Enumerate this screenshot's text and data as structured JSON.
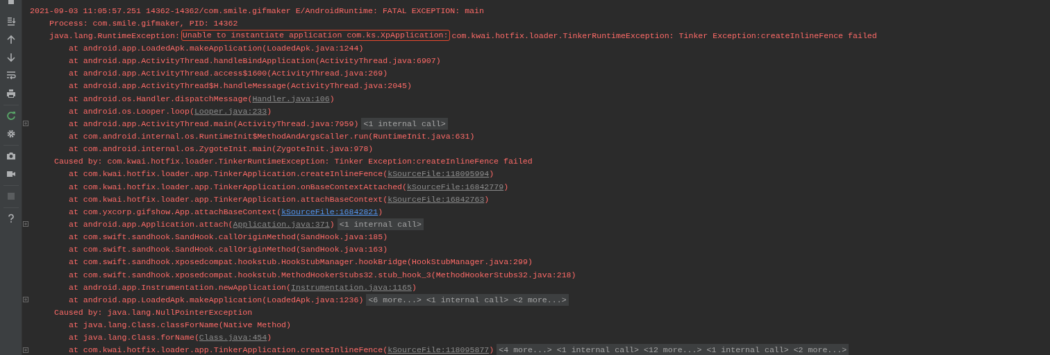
{
  "log": {
    "lines": [
      {
        "kind": "header",
        "foldable": false,
        "segments": [
          {
            "kind": "plain",
            "text": "2021-09-03 11:05:57.251 14362-14362/com.smile.gifmaker E/AndroidRuntime: FATAL EXCEPTION: main"
          }
        ]
      },
      {
        "kind": "detail",
        "foldable": false,
        "segments": [
          {
            "kind": "plain",
            "text": "Process: com.smile.gifmaker, PID: 14362"
          }
        ]
      },
      {
        "kind": "detail",
        "foldable": false,
        "segments": [
          {
            "kind": "plain",
            "text": "java.lang.RuntimeException:"
          },
          {
            "kind": "boxed",
            "text": "Unable to instantiate application com.ks.XpApplication:"
          },
          {
            "kind": "plain",
            "text": "com.kwai.hotfix.loader.TinkerRuntimeException: Tinker Exception:createInlineFence failed"
          }
        ]
      },
      {
        "kind": "frame",
        "foldable": false,
        "segments": [
          {
            "kind": "plain",
            "text": "at android.app.LoadedApk.makeApplication(LoadedApk.java:1244)"
          }
        ]
      },
      {
        "kind": "frame",
        "foldable": false,
        "segments": [
          {
            "kind": "plain",
            "text": "at android.app.ActivityThread.handleBindApplication(ActivityThread.java:6907)"
          }
        ]
      },
      {
        "kind": "frame",
        "foldable": false,
        "segments": [
          {
            "kind": "plain",
            "text": "at android.app.ActivityThread.access$1600(ActivityThread.java:269)"
          }
        ]
      },
      {
        "kind": "frame",
        "foldable": false,
        "segments": [
          {
            "kind": "plain",
            "text": "at android.app.ActivityThread$H.handleMessage(ActivityThread.java:2045)"
          }
        ]
      },
      {
        "kind": "frame",
        "foldable": false,
        "segments": [
          {
            "kind": "plain",
            "text": "at android.os.Handler.dispatchMessage("
          },
          {
            "kind": "link",
            "focused": false,
            "text": "Handler.java:106"
          },
          {
            "kind": "plain",
            "text": ")"
          }
        ]
      },
      {
        "kind": "frame",
        "foldable": false,
        "segments": [
          {
            "kind": "plain",
            "text": "at android.os.Looper.loop("
          },
          {
            "kind": "link",
            "focused": false,
            "text": "Looper.java:233"
          },
          {
            "kind": "plain",
            "text": ")"
          }
        ]
      },
      {
        "kind": "frame",
        "foldable": true,
        "segments": [
          {
            "kind": "plain",
            "text": "at android.app.ActivityThread.main(ActivityThread.java:7959)"
          },
          {
            "kind": "fold",
            "text": "<1 internal call>"
          }
        ]
      },
      {
        "kind": "frame",
        "foldable": false,
        "segments": [
          {
            "kind": "plain",
            "text": "at com.android.internal.os.RuntimeInit$MethodAndArgsCaller.run(RuntimeInit.java:631)"
          }
        ]
      },
      {
        "kind": "frame",
        "foldable": false,
        "segments": [
          {
            "kind": "plain",
            "text": "at com.android.internal.os.ZygoteInit.main(ZygoteInit.java:978)"
          }
        ]
      },
      {
        "kind": "cause",
        "foldable": false,
        "segments": [
          {
            "kind": "plain",
            "text": "Caused by: com.kwai.hotfix.loader.TinkerRuntimeException: Tinker Exception:createInlineFence failed"
          }
        ]
      },
      {
        "kind": "frame",
        "foldable": false,
        "segments": [
          {
            "kind": "plain",
            "text": "at com.kwai.hotfix.loader.app.TinkerApplication.createInlineFence("
          },
          {
            "kind": "link",
            "focused": false,
            "text": "kSourceFile:118095994"
          },
          {
            "kind": "plain",
            "text": ")"
          }
        ]
      },
      {
        "kind": "frame",
        "foldable": false,
        "segments": [
          {
            "kind": "plain",
            "text": "at com.kwai.hotfix.loader.app.TinkerApplication.onBaseContextAttached("
          },
          {
            "kind": "link",
            "focused": false,
            "text": "kSourceFile:16842779"
          },
          {
            "kind": "plain",
            "text": ")"
          }
        ]
      },
      {
        "kind": "frame",
        "foldable": false,
        "segments": [
          {
            "kind": "plain",
            "text": "at com.kwai.hotfix.loader.app.TinkerApplication.attachBaseContext("
          },
          {
            "kind": "link",
            "focused": false,
            "text": "kSourceFile:16842763"
          },
          {
            "kind": "plain",
            "text": ")"
          }
        ]
      },
      {
        "kind": "frame",
        "foldable": false,
        "segments": [
          {
            "kind": "plain",
            "text": "at com.yxcorp.gifshow.App.attachBaseContext("
          },
          {
            "kind": "link",
            "focused": true,
            "text": "kSourceFile:16842821"
          },
          {
            "kind": "plain",
            "text": ")"
          }
        ]
      },
      {
        "kind": "frame",
        "foldable": true,
        "segments": [
          {
            "kind": "plain",
            "text": "at android.app.Application.attach("
          },
          {
            "kind": "link",
            "focused": false,
            "text": "Application.java:371"
          },
          {
            "kind": "plain",
            "text": ")"
          },
          {
            "kind": "fold",
            "text": "<1 internal call>"
          }
        ]
      },
      {
        "kind": "frame",
        "foldable": false,
        "segments": [
          {
            "kind": "plain",
            "text": "at com.swift.sandhook.SandHook.callOriginMethod(SandHook.java:185)"
          }
        ]
      },
      {
        "kind": "frame",
        "foldable": false,
        "segments": [
          {
            "kind": "plain",
            "text": "at com.swift.sandhook.SandHook.callOriginMethod(SandHook.java:163)"
          }
        ]
      },
      {
        "kind": "frame",
        "foldable": false,
        "segments": [
          {
            "kind": "plain",
            "text": "at com.swift.sandhook.xposedcompat.hookstub.HookStubManager.hookBridge(HookStubManager.java:299)"
          }
        ]
      },
      {
        "kind": "frame",
        "foldable": false,
        "segments": [
          {
            "kind": "plain",
            "text": "at com.swift.sandhook.xposedcompat.hookstub.MethodHookerStubs32.stub_hook_3(MethodHookerStubs32.java:218)"
          }
        ]
      },
      {
        "kind": "frame",
        "foldable": false,
        "segments": [
          {
            "kind": "plain",
            "text": "at android.app.Instrumentation.newApplication("
          },
          {
            "kind": "link",
            "focused": false,
            "text": "Instrumentation.java:1165"
          },
          {
            "kind": "plain",
            "text": ")"
          }
        ]
      },
      {
        "kind": "frame",
        "foldable": true,
        "segments": [
          {
            "kind": "plain",
            "text": "at android.app.LoadedApk.makeApplication(LoadedApk.java:1236)"
          },
          {
            "kind": "fold",
            "text": "<6 more...> <1 internal call> <2 more...>"
          }
        ]
      },
      {
        "kind": "cause",
        "foldable": false,
        "segments": [
          {
            "kind": "plain",
            "text": "Caused by: java.lang.NullPointerException"
          }
        ]
      },
      {
        "kind": "frame",
        "foldable": false,
        "segments": [
          {
            "kind": "plain",
            "text": "at java.lang.Class.classForName(Native Method)"
          }
        ]
      },
      {
        "kind": "frame",
        "foldable": false,
        "segments": [
          {
            "kind": "plain",
            "text": "at java.lang.Class.forName("
          },
          {
            "kind": "link",
            "focused": false,
            "text": "Class.java:454"
          },
          {
            "kind": "plain",
            "text": ")"
          }
        ]
      },
      {
        "kind": "frame",
        "foldable": true,
        "segments": [
          {
            "kind": "plain",
            "text": "at com.kwai.hotfix.loader.app.TinkerApplication.createInlineFence("
          },
          {
            "kind": "link",
            "focused": false,
            "text": "kSourceFile:118095877"
          },
          {
            "kind": "plain",
            "text": ")"
          },
          {
            "kind": "fold",
            "text": "<4 more...> <1 internal call> <12 more...> <1 internal call> <2 more...>"
          }
        ]
      }
    ]
  }
}
